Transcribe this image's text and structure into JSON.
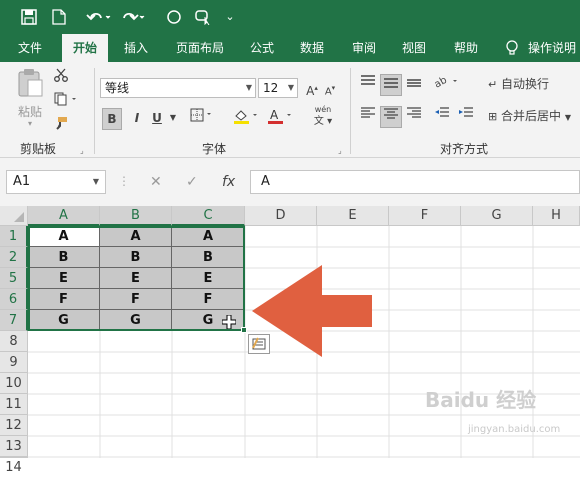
{
  "qat": {
    "save_icon": "save-icon",
    "new_icon": "new-file-icon",
    "undo_icon": "undo-icon",
    "redo_icon": "redo-icon",
    "shape_icon": "circle-icon",
    "more_label": "⌄"
  },
  "tabs": [
    {
      "label": "文件"
    },
    {
      "label": "开始"
    },
    {
      "label": "插入"
    },
    {
      "label": "页面布局"
    },
    {
      "label": "公式"
    },
    {
      "label": "数据"
    },
    {
      "label": "审阅"
    },
    {
      "label": "视图"
    },
    {
      "label": "帮助"
    },
    {
      "label": "操作说明"
    }
  ],
  "ribbon": {
    "paste_label": "粘贴",
    "clipboard_label": "剪贴板",
    "font_group_label": "字体",
    "align_group_label": "对齐方式",
    "font_name": "等线",
    "font_size": "12",
    "bold": "B",
    "italic": "I",
    "underline": "U",
    "wrap_text": "自动换行",
    "merge_center": "合并后居中",
    "font_color": "#d32f2f",
    "fill_color": "#f5e000",
    "brand_color": "#217346"
  },
  "formula_bar": {
    "name_box": "A1",
    "cancel": "✕",
    "enter": "✓",
    "fx": "fx",
    "content": "A"
  },
  "sheet": {
    "columns": [
      "A",
      "B",
      "C",
      "D",
      "E",
      "F",
      "G",
      "H"
    ],
    "rows": [
      "1",
      "2",
      "5",
      "6",
      "7",
      "8",
      "9",
      "10",
      "11",
      "12",
      "13",
      "14"
    ],
    "data": [
      [
        "A",
        "A",
        "A"
      ],
      [
        "B",
        "B",
        "B"
      ],
      [
        "E",
        "E",
        "E"
      ],
      [
        "F",
        "F",
        "F"
      ],
      [
        "G",
        "G",
        "G"
      ]
    ]
  },
  "annotation": {
    "arrow_color": "#e06040"
  },
  "watermark": {
    "text": "Baidu 经验",
    "sub": "jingyan.baidu.com"
  }
}
